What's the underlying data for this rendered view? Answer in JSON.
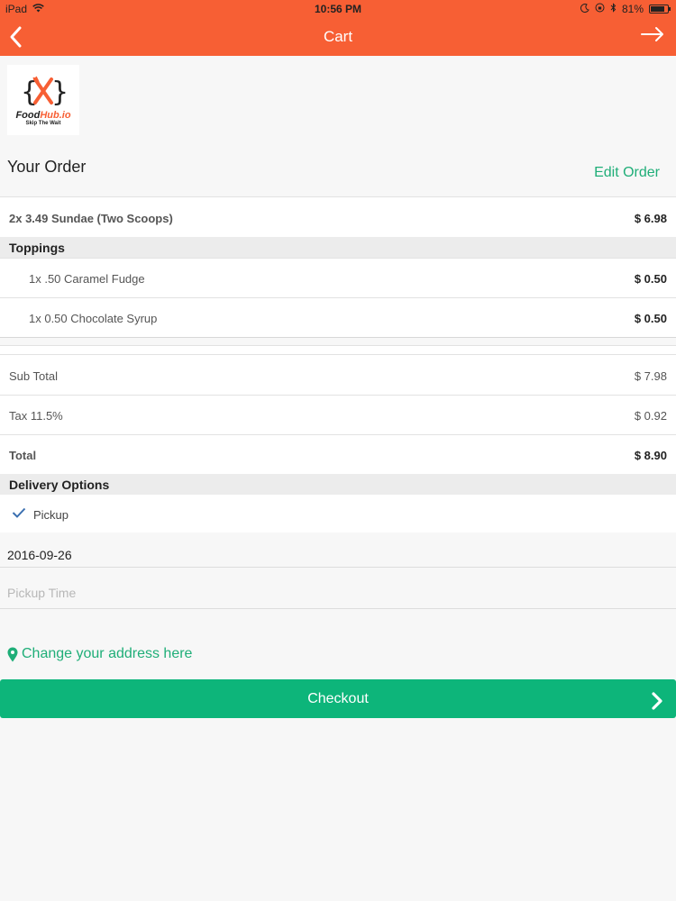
{
  "status": {
    "device": "iPad",
    "time": "10:56 PM",
    "battery": "81%",
    "battery_level": 0.81
  },
  "nav": {
    "title": "Cart"
  },
  "logo": {
    "brand_a": "Food",
    "brand_b": "Hub.io",
    "tagline": "Skip The Wait"
  },
  "order": {
    "heading": "Your Order",
    "edit_label": "Edit Order",
    "item": {
      "label": "2x 3.49 Sundae (Two Scoops)",
      "price": "$ 6.98"
    },
    "toppings_heading": "Toppings",
    "toppings": [
      {
        "label": "1x .50 Caramel Fudge",
        "price": "$ 0.50"
      },
      {
        "label": "1x 0.50 Chocolate Syrup",
        "price": "$ 0.50"
      }
    ]
  },
  "totals": {
    "subtotal": {
      "label": "Sub Total",
      "value": "$ 7.98"
    },
    "tax": {
      "label": "Tax 11.5%",
      "value": "$ 0.92"
    },
    "total": {
      "label": "Total",
      "value": "$ 8.90"
    }
  },
  "delivery": {
    "heading": "Delivery Options",
    "option": "Pickup",
    "date": "2016-09-26",
    "time_placeholder": "Pickup Time"
  },
  "address_link": "Change your address here",
  "checkout_label": "Checkout",
  "colors": {
    "accent_orange": "#f75f34",
    "accent_green": "#0db57a",
    "link_green": "#1fae78"
  }
}
